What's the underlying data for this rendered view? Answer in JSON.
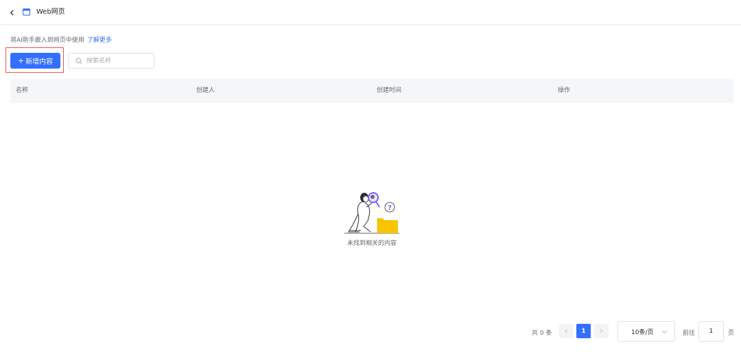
{
  "header": {
    "title": "Web网页",
    "back_icon": "chevron-left-icon",
    "page_icon": "browser-window-icon"
  },
  "description": {
    "text": "将AI助手嵌入到网页中使用",
    "link": "了解更多"
  },
  "toolbar": {
    "add_plus": "+",
    "add_label": "新增内容",
    "search_placeholder": "搜索名称",
    "search_value": ""
  },
  "table": {
    "columns": [
      "名称",
      "创建人",
      "创建时间",
      "操作"
    ],
    "rows": []
  },
  "empty": {
    "text": "未找到相关的内容",
    "illustration": "person-magnifier-folder-illustration"
  },
  "pagination": {
    "total": "共 0 条",
    "prev_icon": "chevron-left-icon",
    "current_page": "1",
    "next_icon": "chevron-right-icon",
    "page_size": "10条/页",
    "goto_label": "前往",
    "goto_value": "1",
    "page_suffix": "页"
  },
  "colors": {
    "primary": "#3370ff",
    "highlight": "#e8534a",
    "table_header_bg": "#f5f6f7",
    "folder": "#f7c600",
    "accent_purple": "#7b61ff"
  }
}
